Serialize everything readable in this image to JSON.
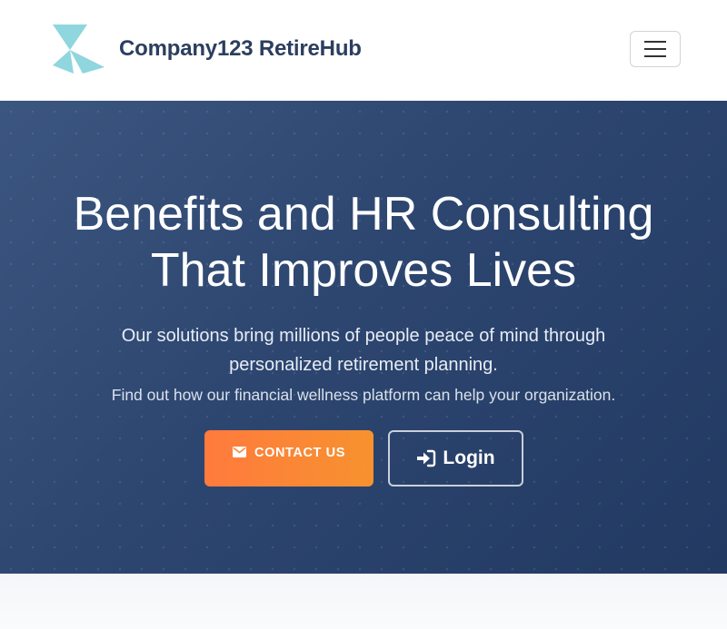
{
  "header": {
    "brand_name": "Company123 RetireHub",
    "logo_icon": "pinwheel-logo",
    "menu_icon": "hamburger-menu-icon"
  },
  "hero": {
    "title_line1": "Benefits and HR Consulting",
    "title_line2": "That Improves Lives",
    "lead": "Our solutions bring millions of people peace of mind through personalized retirement planning.",
    "sub": "Find out how our financial wellness platform can help your organization.",
    "contact_button": {
      "label": "CONTACT US",
      "icon": "envelope-icon"
    },
    "login_button": {
      "label": "Login",
      "icon": "sign-in-icon"
    }
  },
  "colors": {
    "brand_text": "#2c3e5f",
    "logo": "#8fd6de",
    "hero_bg_start": "#3b5680",
    "hero_bg_end": "#223a62",
    "contact_start": "#ff7a3d",
    "contact_end": "#f7922f"
  }
}
